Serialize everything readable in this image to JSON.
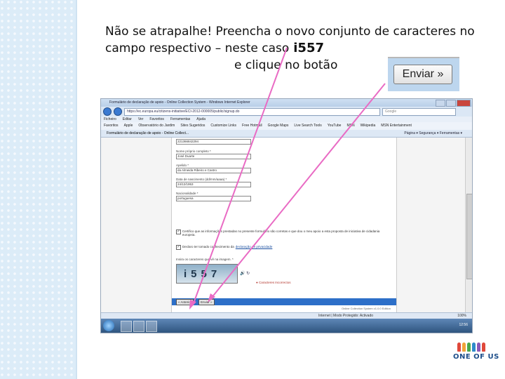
{
  "instructions": {
    "line1": "Não se atrapalhe! Preencha o novo conjunto de caracteres no",
    "line2": "campo respectivo – neste caso",
    "code": "i557",
    "line3": "e clique no botão"
  },
  "enviar_button_label": "Enviar »",
  "browser": {
    "title": "Formulário de declaração de apoio - Online Collection System - Windows Internet Explorer",
    "address": "https://ec.europa.eu/citizens-initiative/ECI-2012-000005/public/signup.do",
    "search_placeholder": "Google",
    "menu": [
      "Ficheiro",
      "Editar",
      "Ver",
      "Favoritos",
      "Ferramentas",
      "Ajuda"
    ],
    "favorites": [
      "Favoritos",
      "Apple",
      "Observatório do Jardim",
      "Sites Sugeridos",
      "Customize Links",
      "Free Hotmail",
      "Google Maps",
      "Live Search Tools",
      "YouTube",
      "MSN",
      "Wikipedia",
      "MSN Entertainment"
    ],
    "tab_title": "Formulário de declaração de apoio - Online Collect...",
    "toolbar_right": "Página ▾  Segurança ▾  Ferramentas ▾",
    "status_zone": "Internet | Modo Protegido: Activado",
    "zoom": "100%",
    "clock": "12:56"
  },
  "form": {
    "id_value": "221366842294",
    "fields": [
      {
        "label": "Nome próprio completo *",
        "value": "José Duarte"
      },
      {
        "label": "Apelido *",
        "value": "da Almeida Ribeiro e Castro"
      },
      {
        "label": "Data de nascimento (dd/mm/aaaa) *",
        "value": "24/12/1953"
      },
      {
        "label": "Nacionalidade *",
        "value": "portuguesa"
      }
    ],
    "certify_text": "Certifico que as informações prestadas no presente formulário são corretas e que dou o meu apoio a esta proposta de iniciativa de cidadania europeia.",
    "privacy_text_prefix": "Declaro ter tomado conhecimento da",
    "privacy_link": "declaração de privacidade",
    "captcha_prompt": "Insira os caracteres que vê na imagem. *",
    "captcha_image_text": "i557",
    "captcha_help": "Caracteres Incorrectos",
    "back_button": "« Anterior",
    "submit_button": "Enviar »",
    "footer": "Online Collection System v1.0.0 Edition"
  },
  "logo_text": "ONE OF US"
}
